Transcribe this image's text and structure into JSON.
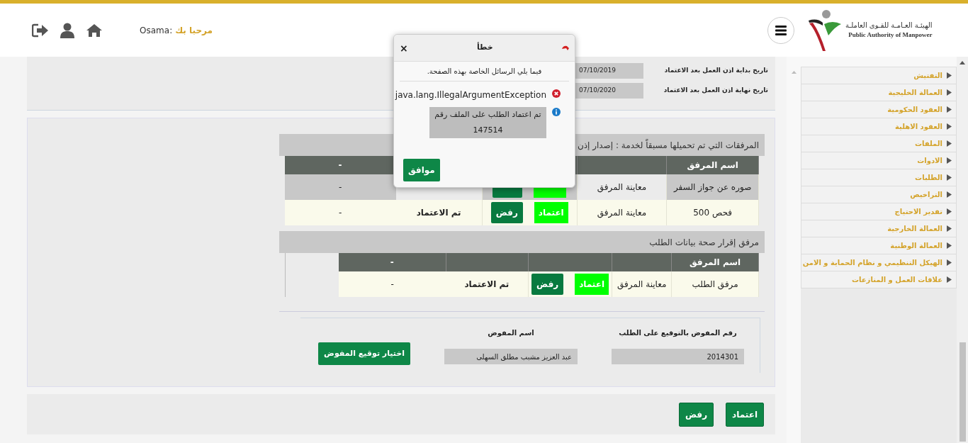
{
  "header": {
    "greeting": "مرحبا بك",
    "user": ":Osama",
    "logo_arabic": "الهيئـة العـامـة للقـوى العاملـة",
    "logo_english": "Public Authority of Manpower"
  },
  "sidebar": {
    "items": [
      {
        "label": "التفتيش"
      },
      {
        "label": "العمالة الخليجية"
      },
      {
        "label": "العقود الحكومية"
      },
      {
        "label": "العقود الاهلية"
      },
      {
        "label": "الملفات"
      },
      {
        "label": "الادوات"
      },
      {
        "label": "الطلبات"
      },
      {
        "label": "التراخيص"
      },
      {
        "label": "تقدير الاحتياج"
      },
      {
        "label": "العمالة الخارجية"
      },
      {
        "label": "العمالة الوطنية"
      },
      {
        "label": "الهيكل التنظيمي و نظام الحماية و الامن"
      },
      {
        "label": "علاقات العمل و المنازعات"
      }
    ]
  },
  "dates": [
    {
      "label": "تاريخ بداية اذن العمل بعد الاعتماد",
      "value": "07/10/2019"
    },
    {
      "label": "تاريخ نهاية اذن العمل بعد الاعتماد",
      "value": "07/10/2020"
    }
  ],
  "sections": [
    {
      "title": "المرفقات التي تم تحميلها مسبقاً لخدمة : إصدار إذن",
      "header_name": "اسم المرفق",
      "header_last": "-",
      "rows": [
        {
          "name": "صوره عن جواز السفر",
          "preview": "معاينة المرفق",
          "column_6": "-",
          "selected": true
        },
        {
          "name": "فحص 500",
          "preview": "معاينة المرفق",
          "approve": "اعتماد",
          "reject": "رفض",
          "status": "تم الاعتماد",
          "column_6": "-",
          "selected": false
        }
      ]
    },
    {
      "title": "مرفق إقرار صحة بيانات الطلب",
      "header_name": "اسم المرفق",
      "header_last": "-",
      "rows": [
        {
          "name": "مرفق الطلب",
          "preview": "معاينة المرفق",
          "approve": "اعتماد",
          "reject": "رفض",
          "status": "تم الاعتماد",
          "column_6": "-",
          "selected": false
        }
      ]
    }
  ],
  "signature": {
    "number_label": "رقم المفوض بالتوقيع على الطلب",
    "number_value": "2014301",
    "name_label": "اسم المفوض",
    "name_value": "عبد العزيز مشبب مطلق السهلى",
    "button": "اختيار توقيع المفوض"
  },
  "actions": [
    "اعتماد",
    "رفض"
  ],
  "dialog": {
    "title": "خطأ",
    "close": "×",
    "intro": "فيما يلي الرسائل الخاصة بهذه الصفحة.",
    "messages": [
      {
        "kind": "error",
        "text": "java.lang.IllegalArgumentException"
      },
      {
        "kind": "info",
        "text": "تم اعتماد الطلب على الملف رقم 147514"
      }
    ],
    "button": "موافق"
  }
}
